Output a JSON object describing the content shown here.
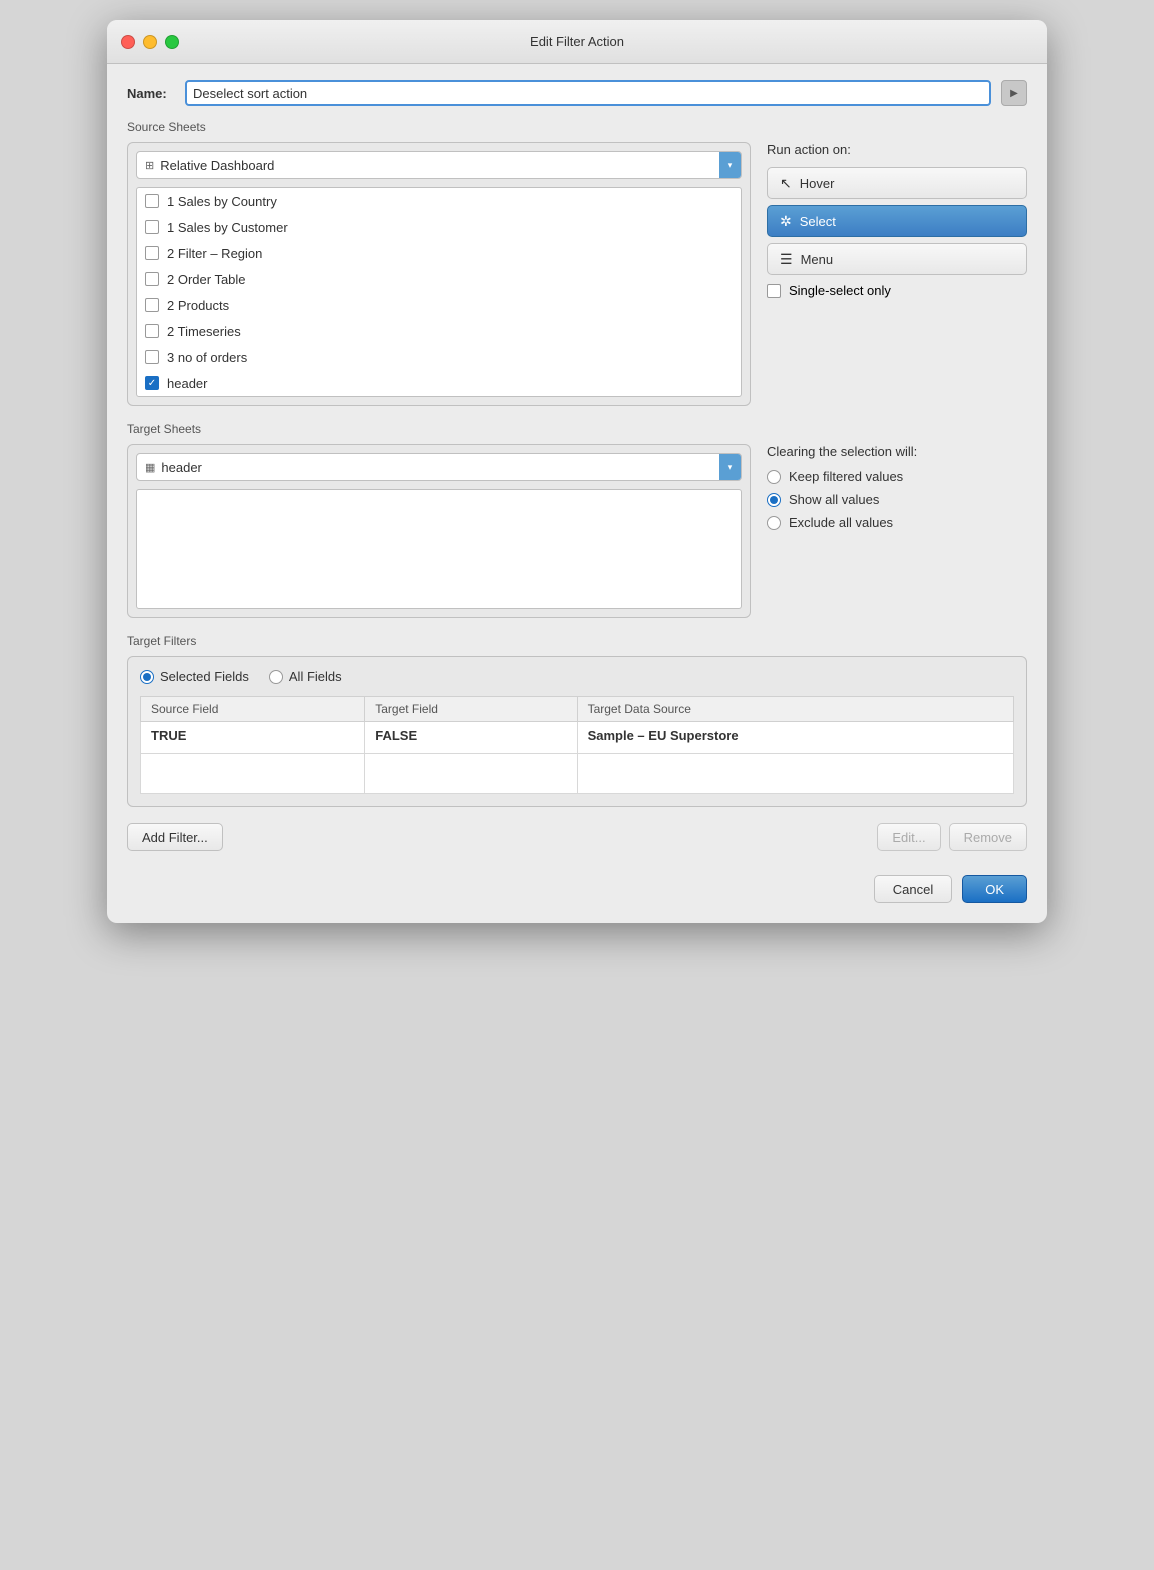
{
  "window": {
    "title": "Edit Filter Action"
  },
  "name_field": {
    "label": "Name:",
    "value": "Deselect sort action"
  },
  "source_sheets": {
    "label": "Source Sheets",
    "dropdown": {
      "icon": "⊞",
      "value": "Relative Dashboard"
    },
    "items": [
      {
        "id": "sales-country",
        "label": "1 Sales by Country",
        "checked": false
      },
      {
        "id": "sales-customer",
        "label": "1 Sales by Customer",
        "checked": false
      },
      {
        "id": "filter-region",
        "label": "2 Filter – Region",
        "checked": false
      },
      {
        "id": "order-table",
        "label": "2 Order Table",
        "checked": false
      },
      {
        "id": "products",
        "label": "2 Products",
        "checked": false
      },
      {
        "id": "timeseries",
        "label": "2 Timeseries",
        "checked": false
      },
      {
        "id": "no-of-orders",
        "label": "3 no of orders",
        "checked": false
      },
      {
        "id": "header",
        "label": "header",
        "checked": true
      }
    ]
  },
  "run_action": {
    "label": "Run action on:",
    "buttons": [
      {
        "id": "hover",
        "label": "Hover",
        "selected": false
      },
      {
        "id": "select",
        "label": "Select",
        "selected": true
      },
      {
        "id": "menu",
        "label": "Menu",
        "selected": false
      }
    ],
    "single_select": {
      "label": "Single-select only",
      "checked": false
    }
  },
  "target_sheets": {
    "label": "Target Sheets",
    "dropdown": {
      "icon": "▦",
      "value": "header"
    }
  },
  "clearing": {
    "label": "Clearing the selection will:",
    "options": [
      {
        "id": "keep",
        "label": "Keep filtered values",
        "checked": false
      },
      {
        "id": "show-all",
        "label": "Show all values",
        "checked": true
      },
      {
        "id": "exclude-all",
        "label": "Exclude all values",
        "checked": false
      }
    ]
  },
  "target_filters": {
    "label": "Target Filters",
    "selected_fields_label": "Selected Fields",
    "all_fields_label": "All Fields",
    "selected_fields_checked": true,
    "table": {
      "columns": [
        "Source Field",
        "Target Field",
        "Target Data Source"
      ],
      "rows": [
        {
          "source": "TRUE",
          "target": "FALSE",
          "data_source": "Sample – EU Superstore"
        }
      ]
    }
  },
  "buttons": {
    "add_filter": "Add Filter...",
    "edit": "Edit...",
    "remove": "Remove",
    "cancel": "Cancel",
    "ok": "OK"
  }
}
